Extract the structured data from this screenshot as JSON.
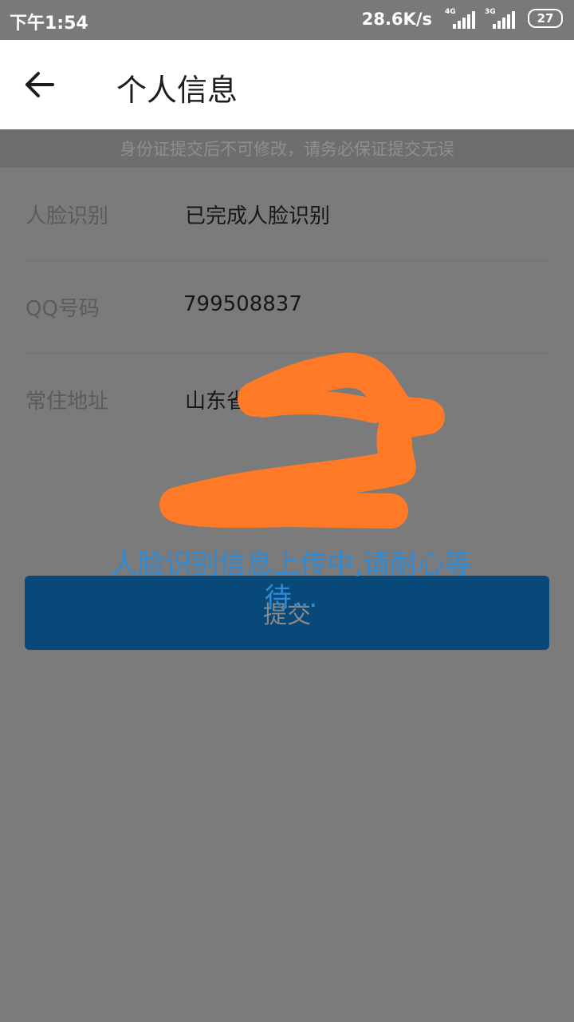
{
  "status_bar": {
    "time": "下午1:54",
    "speed": "28.6K/s",
    "network_1": "4G",
    "network_2": "3G",
    "battery": "27"
  },
  "header": {
    "back_icon": "arrow-left-icon",
    "title": "个人信息"
  },
  "notice": "身份证提交后不可修改，请务必保证提交无误",
  "form": {
    "rows": [
      {
        "label": "人脸识别",
        "value": "已完成人脸识别"
      },
      {
        "label": "QQ号码",
        "value": "799508837"
      },
      {
        "label": "常住地址",
        "value": "山东省"
      }
    ]
  },
  "submit_label": "提交",
  "toast": "人脸识别信息上传中,请耐心等待...",
  "colors": {
    "overlay": "#7b7b7b",
    "button": "#08497a",
    "toast_text": "#2f8bd6",
    "redaction": "#ff7a26"
  }
}
